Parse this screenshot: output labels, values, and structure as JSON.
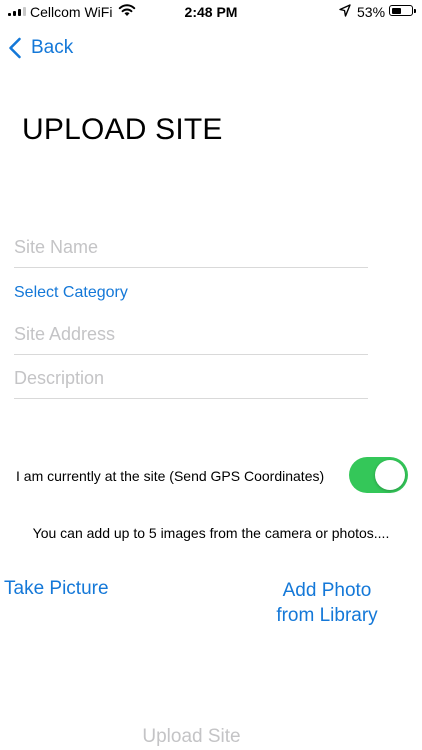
{
  "status_bar": {
    "carrier": "Cellcom WiFi",
    "time": "2:48 PM",
    "battery_percent": "53%",
    "battery_level": 0.53
  },
  "nav": {
    "back_label": "Back"
  },
  "page": {
    "title": "UPLOAD SITE"
  },
  "form": {
    "site_name_placeholder": "Site Name",
    "site_name_value": "",
    "select_category_label": "Select Category",
    "site_address_placeholder": "Site Address",
    "site_address_value": "",
    "description_placeholder": "Description",
    "description_value": ""
  },
  "gps": {
    "label": "I am currently at the site (Send GPS Coordinates)",
    "enabled": true
  },
  "images": {
    "info_text": "You can add up to 5 images from the camera or photos....",
    "take_picture_label": "Take Picture",
    "add_photo_line1": "Add Photo",
    "add_photo_line2": "from Library"
  },
  "actions": {
    "upload_label": "Upload Site"
  },
  "colors": {
    "accent": "#1478d8",
    "toggle_on": "#34c759",
    "placeholder": "#c4c4c6"
  },
  "icons": [
    "signal-icon",
    "wifi-icon",
    "location-arrow-icon",
    "battery-icon",
    "chevron-left-icon"
  ]
}
